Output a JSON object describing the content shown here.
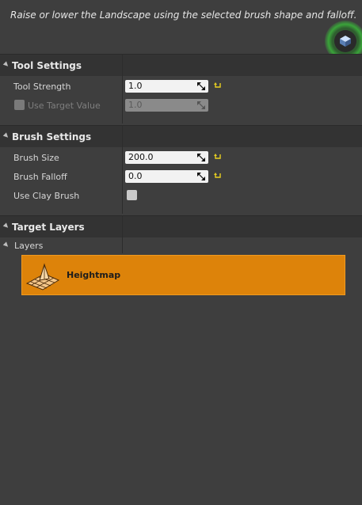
{
  "description": "Raise or lower the Landscape using the selected brush shape and falloff.",
  "mode_icon": "landscape-mode-icon",
  "tool_settings": {
    "title": "Tool Settings",
    "tool_strength": {
      "label": "Tool Strength",
      "value": "1.0"
    },
    "use_target_value": {
      "label": "Use Target Value",
      "value": "1.0",
      "checked": false,
      "enabled": false
    }
  },
  "brush_settings": {
    "title": "Brush Settings",
    "brush_size": {
      "label": "Brush Size",
      "value": "200.0"
    },
    "brush_falloff": {
      "label": "Brush Falloff",
      "value": "0.0"
    },
    "use_clay_brush": {
      "label": "Use Clay Brush",
      "checked": false
    }
  },
  "target_layers": {
    "title": "Target Layers",
    "layers_label": "Layers",
    "items": [
      {
        "name": "Heightmap",
        "icon": "heightmap-icon",
        "selected": true
      }
    ]
  },
  "colors": {
    "background": "#3e3e3e",
    "header": "#333333",
    "selected_layer": "#dd830a",
    "reset_arrow": "#e8d020",
    "mode_glow": "#3aa43a"
  }
}
